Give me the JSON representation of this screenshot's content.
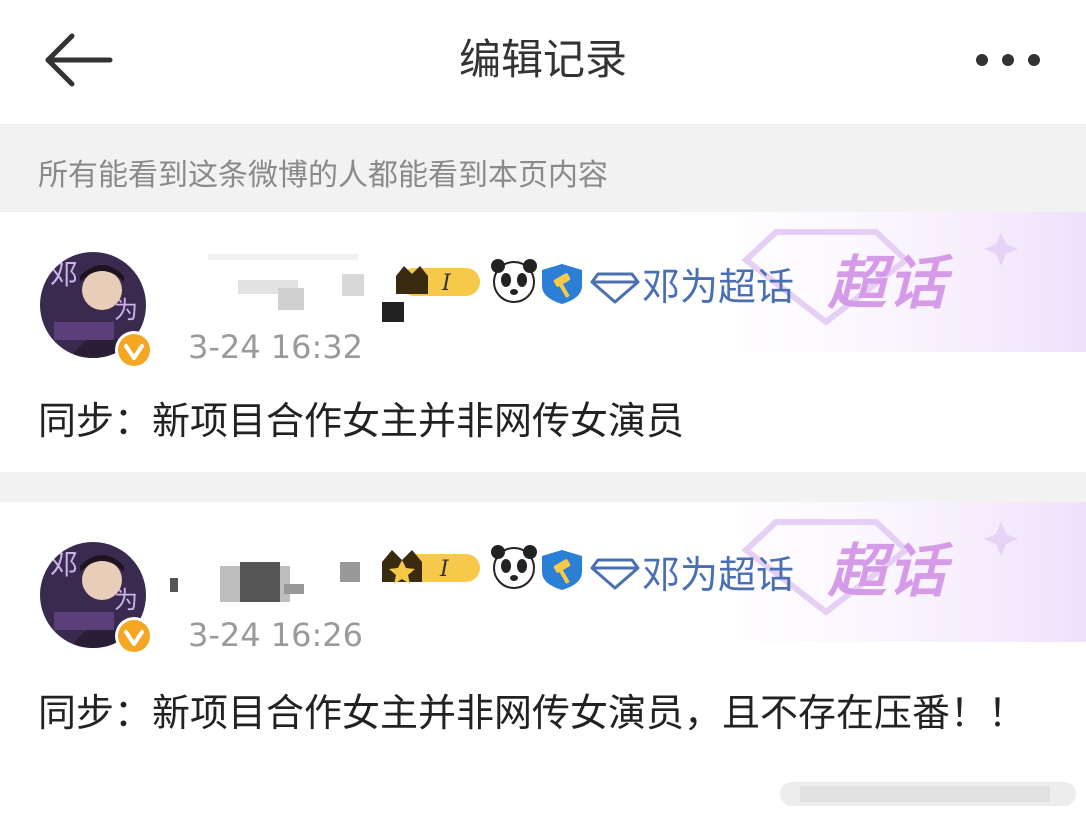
{
  "header": {
    "title": "编辑记录"
  },
  "notice": {
    "text": "所有能看到这条微博的人都能看到本页内容"
  },
  "records": [
    {
      "supertopic": "邓为超话",
      "chaohua_logo": "超话",
      "level": "I",
      "time": "3-24 16:32",
      "text": "同步：新项目合作女主并非网传女演员"
    },
    {
      "supertopic": "邓为超话",
      "chaohua_logo": "超话",
      "level": "I",
      "time": "3-24 16:26",
      "text": "同步：新项目合作女主并非网传女演员，且不存在压番！！"
    }
  ],
  "icons": {
    "back": "arrow-left-icon",
    "more": "more-dots-icon",
    "verified": "verified-badge-icon",
    "panda": "panda-icon",
    "shield": "shield-hammer-icon",
    "diamond": "diamond-icon"
  },
  "colors": {
    "supertopic_text": "#4a6fb3",
    "chaohua_logo": "#d59ae8",
    "verified_badge": "#f5a623",
    "separator": "#f2f2f2"
  }
}
